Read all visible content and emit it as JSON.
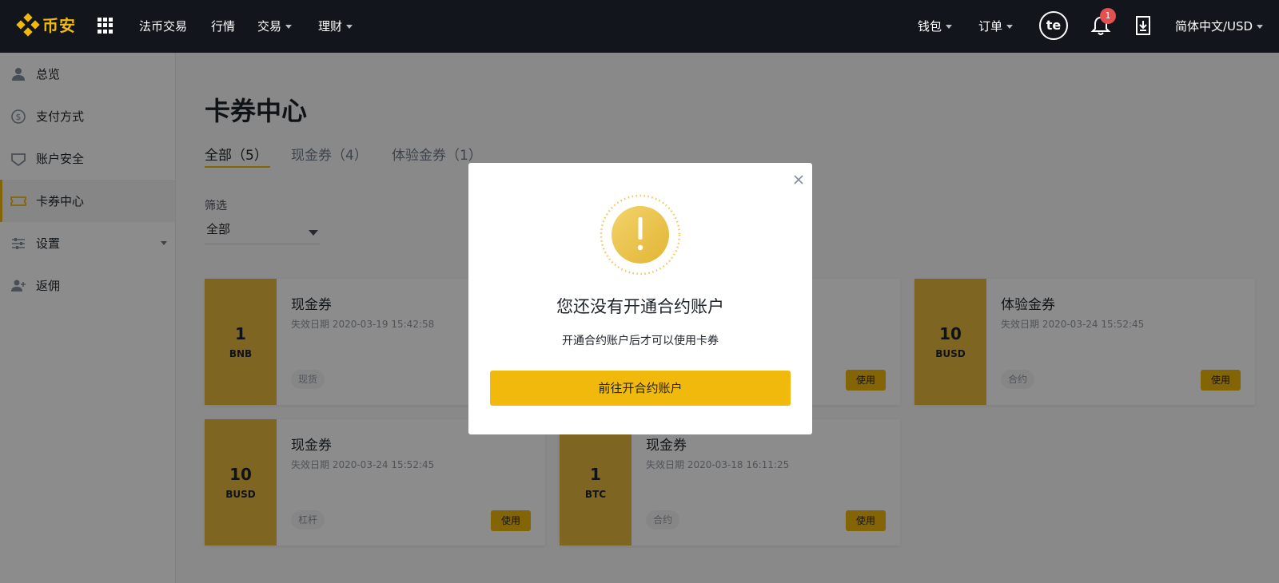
{
  "header": {
    "logo_text": "币安",
    "nav": [
      {
        "label": "法币交易"
      },
      {
        "label": "行情"
      },
      {
        "label": "交易"
      },
      {
        "label": "理财"
      }
    ],
    "wallet_label": "钱包",
    "orders_label": "订单",
    "avatar_text": "te",
    "notification_count": "1",
    "language_label": "简体中文/USD",
    "brand_color": "#f0b90b"
  },
  "sidebar": {
    "items": [
      {
        "label": "总览",
        "icon": "user-icon"
      },
      {
        "label": "支付方式",
        "icon": "dollar-circle-icon"
      },
      {
        "label": "账户安全",
        "icon": "shield-icon"
      },
      {
        "label": "卡券中心",
        "icon": "ticket-icon"
      },
      {
        "label": "设置",
        "icon": "sliders-icon"
      },
      {
        "label": "返佣",
        "icon": "add-user-icon"
      }
    ]
  },
  "main": {
    "title": "卡券中心",
    "tabs": [
      {
        "label": "全部（5）"
      },
      {
        "label": "现金券（4）"
      },
      {
        "label": "体验金券（1）"
      }
    ],
    "filter_label": "筛选",
    "filter_value": "全部",
    "use_label": "使用",
    "vouchers": [
      {
        "amount": "1",
        "unit": "BNB",
        "title": "现金券",
        "expiry": "失效日期 2020-03-19 15:42:58",
        "tag": "现货"
      },
      {
        "amount": "10",
        "unit": "BUSD",
        "title": "体验金券",
        "expiry": "失效日期 2020-03-24 15:52:45",
        "tag": "合约"
      },
      {
        "amount": "10",
        "unit": "BUSD",
        "title": "现金券",
        "expiry": "失效日期 2020-03-24 15:52:45",
        "tag": "杠杆"
      },
      {
        "amount": "1",
        "unit": "BTC",
        "title": "现金券",
        "expiry": "失效日期 2020-03-18 16:11:25",
        "tag": "合约"
      }
    ]
  },
  "modal": {
    "icon": "exclamation-icon",
    "title": "您还没有开通合约账户",
    "description": "开通合约账户后才可以使用卡券",
    "button_label": "前往开合约账户"
  }
}
